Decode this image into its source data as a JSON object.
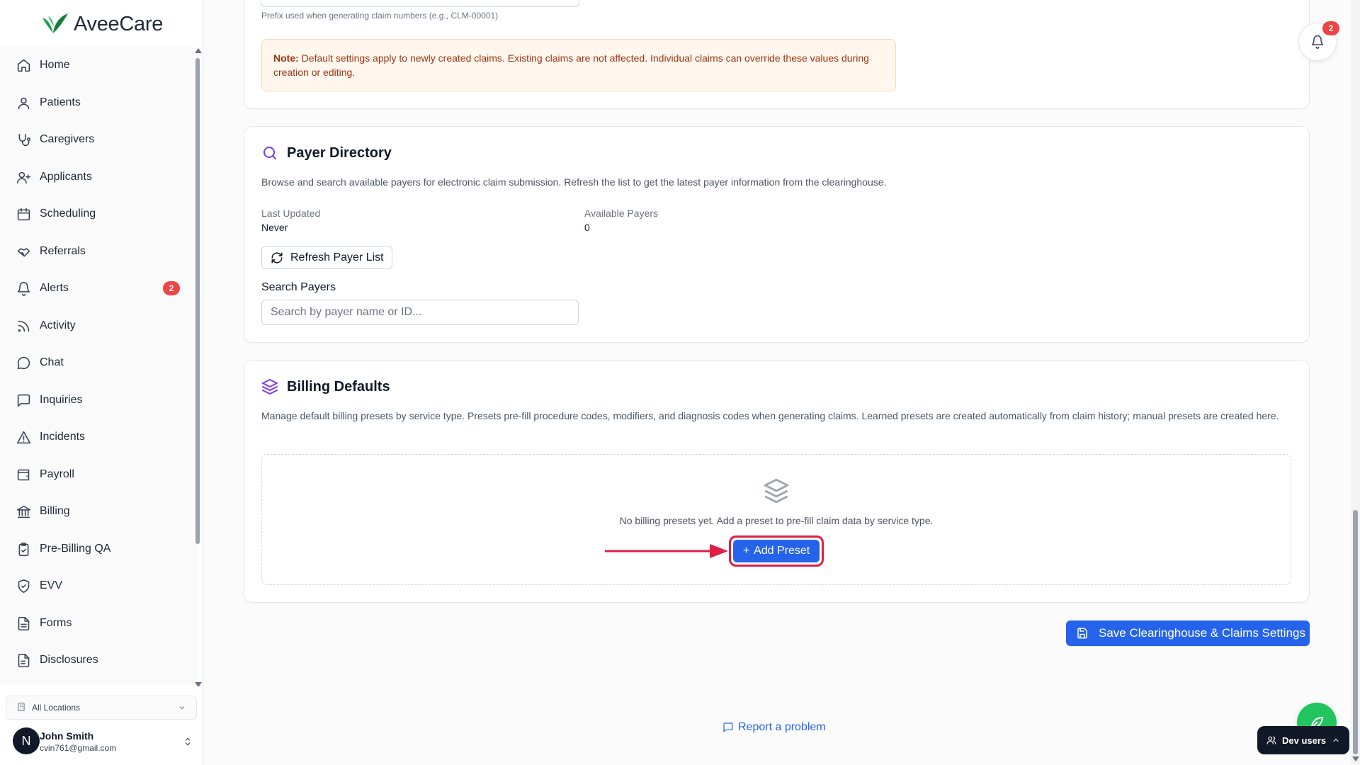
{
  "app": {
    "name": "AveeCare"
  },
  "sidebar": {
    "items": [
      {
        "label": "Home",
        "icon": "home-icon"
      },
      {
        "label": "Patients",
        "icon": "user-icon"
      },
      {
        "label": "Caregivers",
        "icon": "stethoscope-icon"
      },
      {
        "label": "Applicants",
        "icon": "user-plus-icon"
      },
      {
        "label": "Scheduling",
        "icon": "calendar-icon"
      },
      {
        "label": "Referrals",
        "icon": "handshake-icon"
      },
      {
        "label": "Alerts",
        "icon": "bell-icon",
        "badge": "2"
      },
      {
        "label": "Activity",
        "icon": "rss-icon"
      },
      {
        "label": "Chat",
        "icon": "message-circle-icon"
      },
      {
        "label": "Inquiries",
        "icon": "message-square-icon"
      },
      {
        "label": "Incidents",
        "icon": "alert-triangle-icon"
      },
      {
        "label": "Payroll",
        "icon": "wallet-icon"
      },
      {
        "label": "Billing",
        "icon": "landmark-icon"
      },
      {
        "label": "Pre-Billing QA",
        "icon": "clipboard-check-icon"
      },
      {
        "label": "EVV",
        "icon": "shield-check-icon"
      },
      {
        "label": "Forms",
        "icon": "file-text-icon"
      },
      {
        "label": "Disclosures",
        "icon": "file-icon"
      }
    ],
    "location_select": "All Locations",
    "user": {
      "initial": "N",
      "name": "John Smith",
      "email": "cvin761@gmail.com"
    }
  },
  "claims_settings": {
    "prefix_hint": "Prefix used when generating claim numbers (e.g., CLM-00001)",
    "note_label": "Note:",
    "note_text": " Default settings apply to newly created claims. Existing claims are not affected. Individual claims can override these values during creation or editing."
  },
  "payer_directory": {
    "title": "Payer Directory",
    "description": "Browse and search available payers for electronic claim submission. Refresh the list to get the latest payer information from the clearinghouse.",
    "last_updated_label": "Last Updated",
    "last_updated_value": "Never",
    "available_payers_label": "Available Payers",
    "available_payers_value": "0",
    "refresh_button": "Refresh Payer List",
    "search_label": "Search Payers",
    "search_placeholder": "Search by payer name or ID..."
  },
  "billing_defaults": {
    "title": "Billing Defaults",
    "description": "Manage default billing presets by service type. Presets pre-fill procedure codes, modifiers, and diagnosis codes when generating claims. Learned presets are created automatically from claim history; manual presets are created here.",
    "empty_text": "No billing presets yet. Add a preset to pre-fill claim data by service type.",
    "add_button": "Add Preset"
  },
  "save_button": "Save Clearinghouse & Claims Settings",
  "report_link": "Report a problem",
  "notifications": {
    "badge": "2"
  },
  "dev_users": "Dev users",
  "colors": {
    "primary": "#2563eb",
    "badge": "#ef4444",
    "accent_purple": "#7c3aed",
    "highlight": "#e11d48"
  }
}
